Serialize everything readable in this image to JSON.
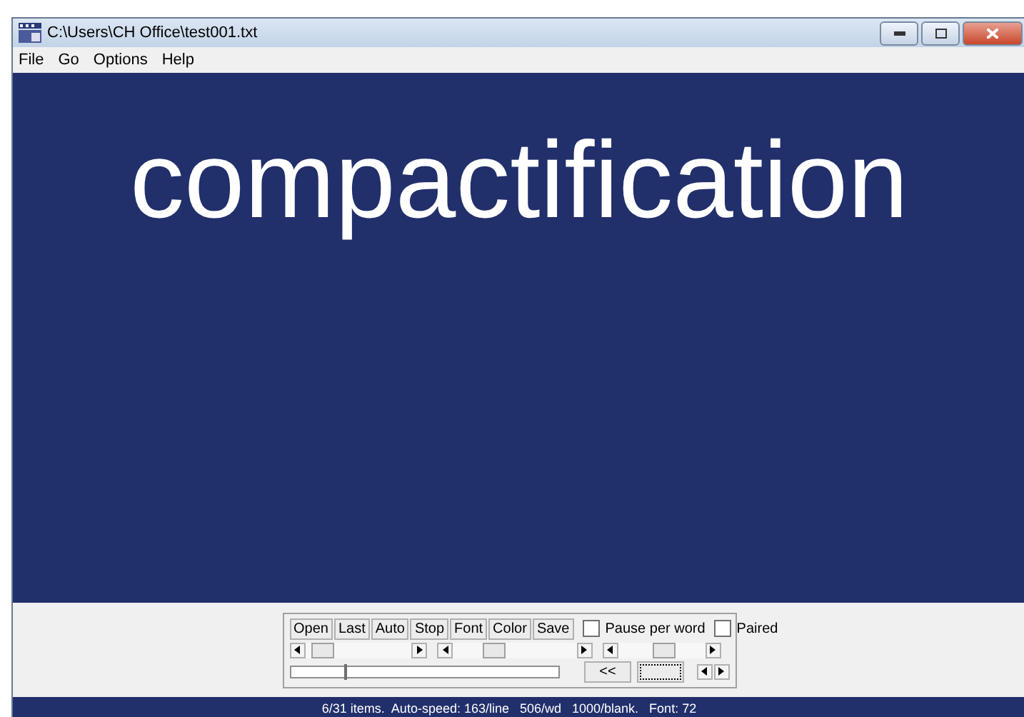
{
  "window": {
    "title": "C:\\Users\\CH Office\\test001.txt"
  },
  "menu": [
    {
      "label": "File"
    },
    {
      "label": "Go"
    },
    {
      "label": "Options"
    },
    {
      "label": "Help"
    }
  ],
  "display": {
    "word": "compactification"
  },
  "buttons": [
    {
      "label": "Open"
    },
    {
      "label": "Last"
    },
    {
      "label": "Auto"
    },
    {
      "label": "Stop"
    },
    {
      "label": "Font"
    },
    {
      "label": "Color"
    },
    {
      "label": "Save"
    }
  ],
  "checkboxes": [
    {
      "label": "Pause per word",
      "checked": false
    },
    {
      "label": "Paired",
      "checked": false
    }
  ],
  "sliders": [
    {
      "level": 0.08
    },
    {
      "level": 0.3
    },
    {
      "level": 0.55
    }
  ],
  "progress": {
    "level": 0.2
  },
  "back_button": "<<",
  "status_bar": "6/31 items.  Auto-speed: 163/line   506/wd   1000/blank.   Font: 72"
}
